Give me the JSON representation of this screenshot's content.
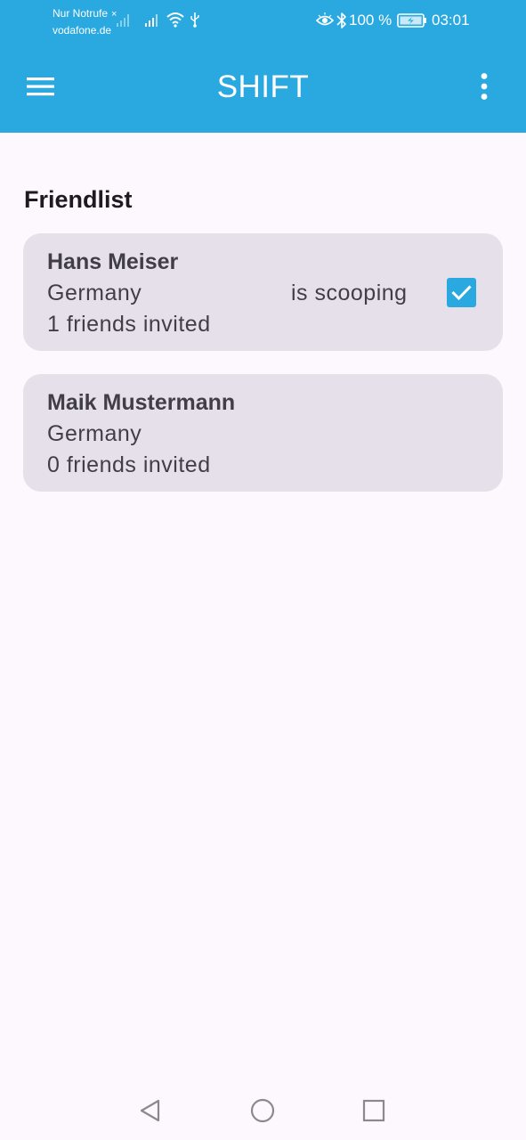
{
  "status_bar": {
    "carrier_line1": "Nur Notrufe",
    "carrier_line2": "vodafone.de",
    "no_sim_mark": "×",
    "battery_text": "100 %",
    "time": "03:01",
    "icons": [
      "signal-bars-icon",
      "wifi-icon",
      "usb-icon",
      "eye-icon",
      "bluetooth-icon",
      "battery-charging-icon"
    ]
  },
  "app_bar": {
    "title": "SHIFT",
    "menu_icon": "hamburger-menu-icon",
    "overflow_icon": "more-vertical-icon"
  },
  "friendlist": {
    "title": "Friendlist",
    "friends": [
      {
        "name": "Hans Meiser",
        "country": "Germany",
        "invited": "1 friends invited",
        "status": "is scooping",
        "checked": true
      },
      {
        "name": "Maik Mustermann",
        "country": "Germany",
        "invited": "0 friends invited",
        "status": "",
        "checked": false
      }
    ]
  },
  "nav_bar": {
    "icons": [
      "back-triangle-icon",
      "home-circle-icon",
      "recents-square-icon"
    ]
  },
  "colors": {
    "accent": "#29a9e0",
    "card_background": "#e6e0ea",
    "page_background": "#fdf8fd",
    "text_dark": "#1d1b20",
    "card_text": "#423e49"
  }
}
